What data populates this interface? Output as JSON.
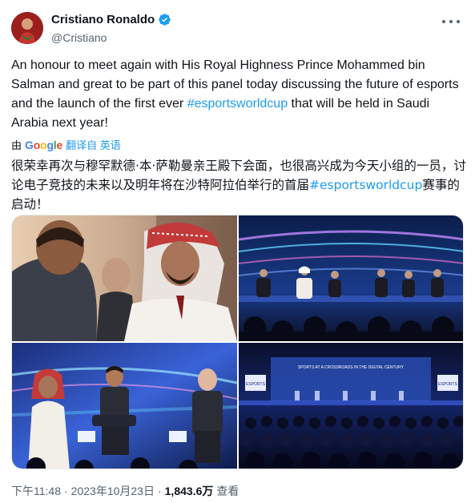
{
  "author": {
    "display_name": "Cristiano Ronaldo",
    "handle": "@Cristiano",
    "verified": true
  },
  "tweet": {
    "text_before_hashtag": "An honour to meet again with His Royal Highness Prince Mohammed bin Salman and great to be part of this panel today discussing the future of esports and the launch of the first ever ",
    "hashtag": "#esportsworldcup",
    "text_after_hashtag": " that will be held in Saudi Arabia next year!"
  },
  "translation": {
    "by_label": "由",
    "provider": "Google",
    "translated_from_label": "翻译自 英语",
    "text_before_hashtag": "很荣幸再次与穆罕默德·本·萨勒曼亲王殿下会面，也很高兴成为今天小组的一员，讨论电子竞技的未来以及明年将在沙特阿拉伯举行的首届",
    "hashtag": "#esportsworldcup",
    "text_after_hashtag": "赛事的启动！"
  },
  "media": {
    "photos": [
      {
        "label": "Meeting with Prince"
      },
      {
        "label": "Panel stage"
      },
      {
        "label": "Panel discussion"
      },
      {
        "label": "Auditorium audience"
      }
    ],
    "stage_logo_text": "ESPORTS",
    "banner_text": "SPORTS AT A CROSSROADS IN THE DIGITAL CENTURY"
  },
  "meta": {
    "time": "下午11:48",
    "separator": "·",
    "date": "2023年10月23日",
    "views_count": "1,843.6万",
    "views_label": "查看"
  },
  "colors": {
    "accent": "#1d9bf0",
    "text_primary": "#0f1419",
    "text_secondary": "#536471"
  }
}
